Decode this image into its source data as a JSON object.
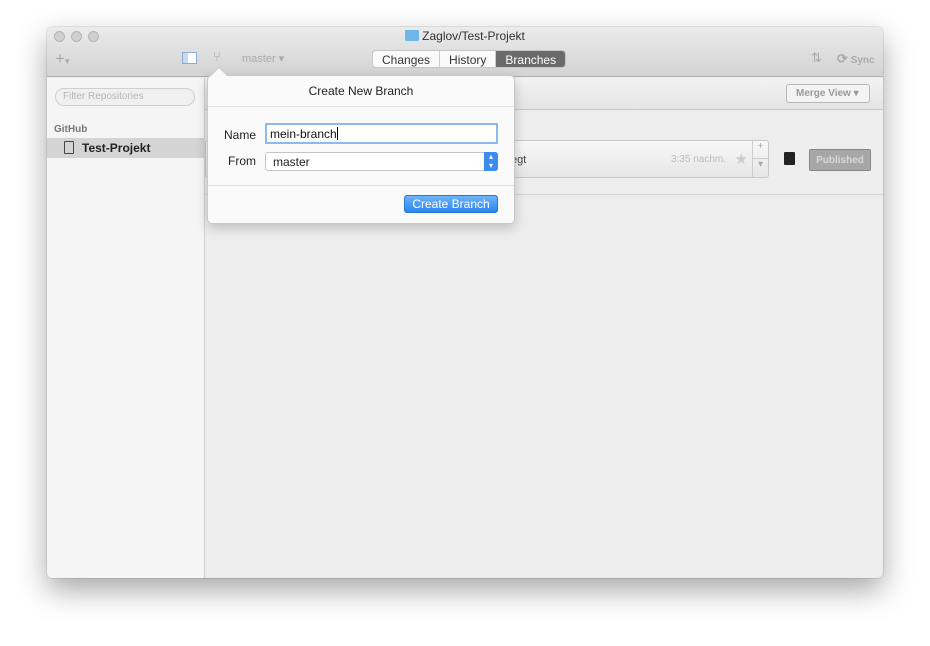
{
  "window": {
    "title": "Zaglov/Test-Projekt"
  },
  "toolbar": {
    "add": "+",
    "add_caret": "▾",
    "branch": "master ▾",
    "tabs": [
      {
        "label": "Changes"
      },
      {
        "label": "History"
      },
      {
        "label": "Branches",
        "active": true
      }
    ],
    "sync": "Sync"
  },
  "sidebar": {
    "filter_placeholder": "Filter Repositories",
    "section": "GitHub",
    "repos": [
      {
        "label": "Test-Projekt",
        "selected": true
      }
    ]
  },
  "content": {
    "merge_view": "Merge View",
    "branch_row": {
      "text_partial": "egt",
      "time": "3:35 nachm.",
      "plus": "+",
      "caret": "▾"
    },
    "published": "Published"
  },
  "popover": {
    "title": "Create New Branch",
    "name_label": "Name",
    "name_value": "mein-branch",
    "from_label": "From",
    "from_value": "master",
    "create": "Create Branch"
  },
  "colors": {
    "accent": "#2a86f0",
    "active_tab": "#6a6a6a"
  }
}
